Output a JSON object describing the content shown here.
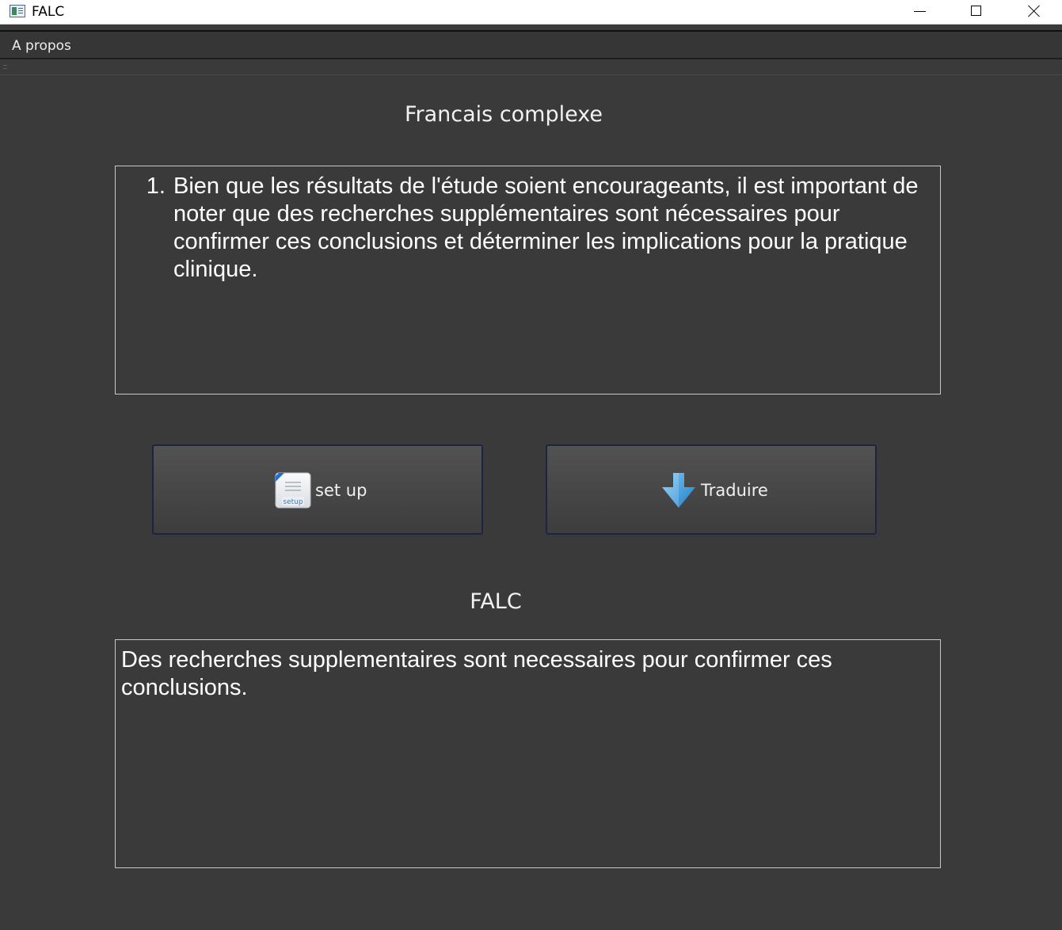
{
  "window": {
    "title": "FALC"
  },
  "menu": {
    "items": [
      "A propos"
    ]
  },
  "input_section": {
    "label": "Francais complexe",
    "list_number": "1.",
    "text": "Bien que les résultats de l'étude soient encourageants, il est important de noter que des recherches supplémentaires sont nécessaires pour confirmer ces conclusions et déterminer les implications pour la pratique clinique."
  },
  "buttons": {
    "setup_label": "set up",
    "setup_icon": "setup-icon",
    "translate_label": "Traduire",
    "translate_icon": "arrow-down-icon"
  },
  "output_section": {
    "label": "FALC",
    "text": "Des recherches supplementaires sont necessaires pour confirmer ces conclusions."
  },
  "colors": {
    "background": "#3a3a3a",
    "button_border": "#1a2540",
    "arrow_blue": "#3a9ad9"
  }
}
